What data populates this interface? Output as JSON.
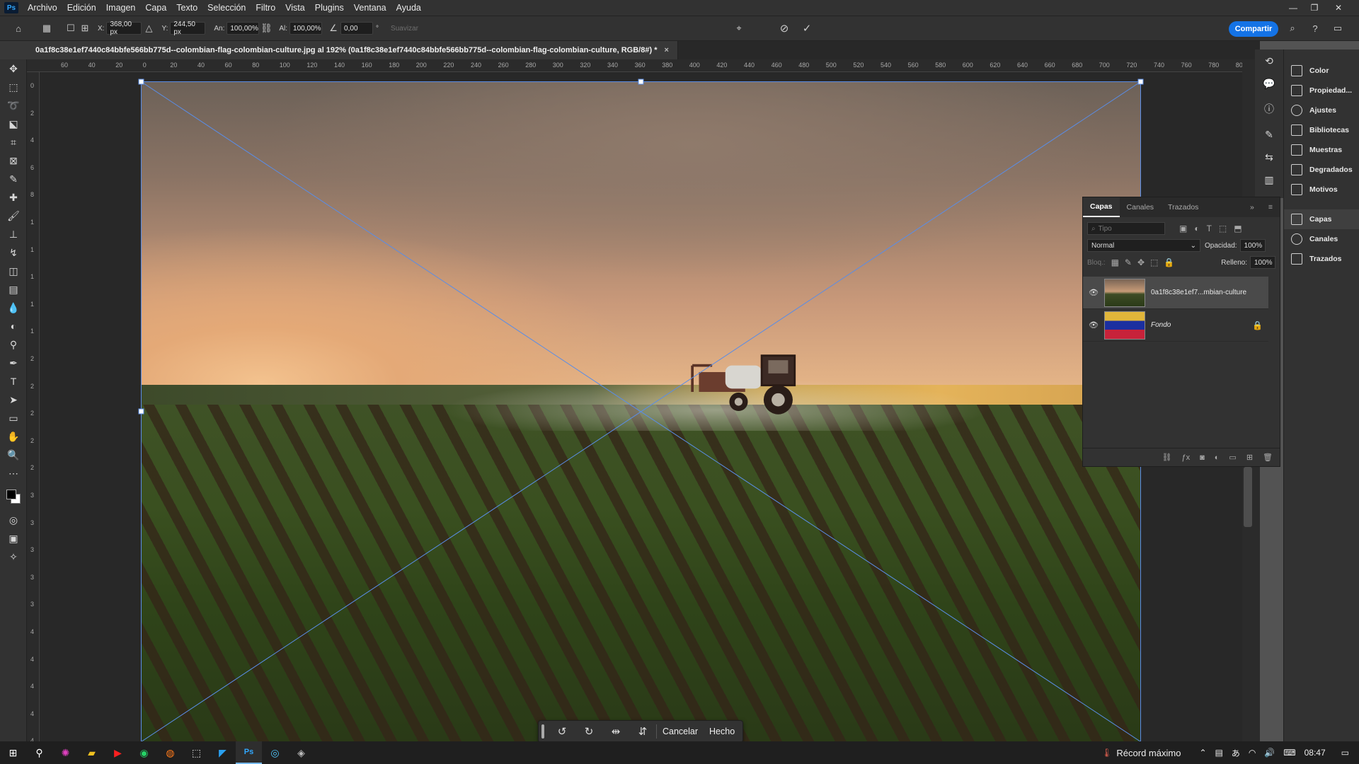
{
  "app": {
    "logo": "Ps"
  },
  "menubar": {
    "items": [
      "Archivo",
      "Edición",
      "Imagen",
      "Capa",
      "Texto",
      "Selección",
      "Filtro",
      "Vista",
      "Plugins",
      "Ventana",
      "Ayuda"
    ]
  },
  "options": {
    "x_label": "X:",
    "x_value": "368,00 px",
    "y_label": "Y:",
    "y_value": "244,50 px",
    "w_label": "An:",
    "w_value": "100,00%",
    "h_label": "Al:",
    "h_value": "100,00%",
    "angle_value": "0,00",
    "degree_unit": "°",
    "smooth_label": "Suavizar",
    "share_label": "Compartir"
  },
  "document": {
    "tab_title": "0a1f8c38e1ef7440c84bbfe566bb775d--colombian-flag-colombian-culture.jpg al 192% (0a1f8c38e1ef7440c84bbfe566bb775d--colombian-flag-colombian-culture, RGB/8#) *",
    "close": "×"
  },
  "ruler": {
    "h_ticks": [
      "60",
      "40",
      "20",
      "0",
      "20",
      "40",
      "60",
      "80",
      "100",
      "120",
      "140",
      "160",
      "180",
      "200",
      "220",
      "240",
      "260",
      "280",
      "300",
      "320",
      "340",
      "360",
      "380",
      "400",
      "420",
      "440",
      "460",
      "480",
      "500",
      "520",
      "540",
      "560",
      "580",
      "600",
      "620",
      "640",
      "660",
      "680",
      "700",
      "720",
      "740",
      "760",
      "780",
      "800"
    ],
    "v_ticks": [
      "0",
      "2",
      "4",
      "6",
      "8",
      "1",
      "1",
      "1",
      "1",
      "1",
      "2",
      "2",
      "2",
      "2",
      "2",
      "3",
      "3",
      "3",
      "3",
      "3",
      "4",
      "4",
      "4",
      "4",
      "4"
    ]
  },
  "right_dock": {
    "items": [
      {
        "label": "Color",
        "icon": "color-icon"
      },
      {
        "label": "Propiedad...",
        "icon": "properties-icon"
      },
      {
        "label": "Ajustes",
        "icon": "adjustments-icon"
      },
      {
        "label": "Bibliotecas",
        "icon": "libraries-icon"
      },
      {
        "label": "Muestras",
        "icon": "swatches-icon"
      },
      {
        "label": "Degradados",
        "icon": "gradients-icon"
      },
      {
        "label": "Motivos",
        "icon": "patterns-icon"
      },
      {
        "label": "Capas",
        "icon": "layers-icon"
      },
      {
        "label": "Canales",
        "icon": "channels-icon"
      },
      {
        "label": "Trazados",
        "icon": "paths-icon"
      }
    ]
  },
  "layers_panel": {
    "tabs": [
      "Capas",
      "Canales",
      "Trazados"
    ],
    "search_placeholder": "Tipo",
    "blend_mode": "Normal",
    "opacity_label": "Opacidad:",
    "opacity_value": "100%",
    "lock_label": "Bloq.:",
    "fill_label": "Relleno:",
    "fill_value": "100%",
    "layers": [
      {
        "name": "0a1f8c38e1ef7...mbian-culture",
        "selected": true
      },
      {
        "name": "Fondo",
        "locked": true
      }
    ]
  },
  "context_bar": {
    "cancel": "Cancelar",
    "done": "Hecho"
  },
  "taskbar": {
    "weather_text": "Récord máximo",
    "time": "08:47"
  },
  "colors": {
    "accent": "#1473e6",
    "bbox_line": "#5a8de6"
  }
}
